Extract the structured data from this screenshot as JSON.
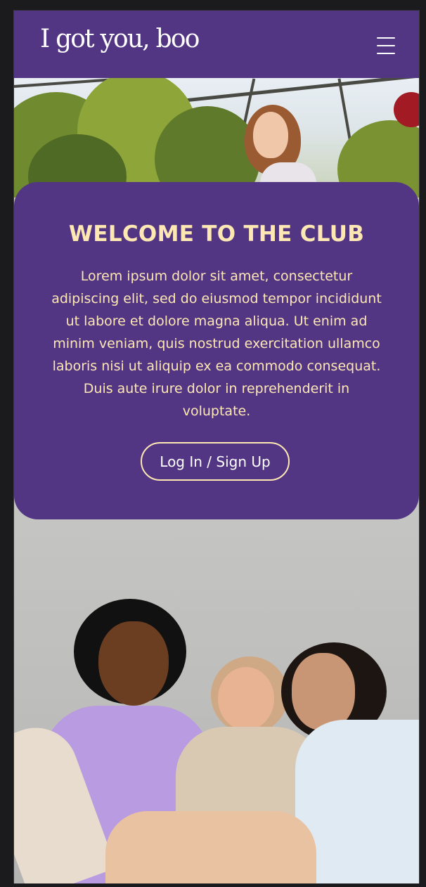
{
  "header": {
    "logo": "I got you, boo",
    "menu_icon": "hamburger-menu-icon"
  },
  "hero_top": {
    "image": "woman-smiling-in-greenhouse-photo"
  },
  "welcome_card": {
    "title": "WELCOME TO THE CLUB",
    "body": "Lorem ipsum dolor sit amet, consectetur adipiscing elit, sed do eiusmod tempor incididunt ut labore et dolore magna aliqua. Ut enim ad minim veniam, quis nostrud exercitation ullamco laboris nisi ut aliquip ex ea commodo consequat. Duis aute irure dolor in reprehenderit in voluptate.",
    "button_label": "Log In / Sign Up"
  },
  "hero_bottom": {
    "image": "three-women-laughing-photo"
  },
  "colors": {
    "brand_purple": "#523684",
    "cream_text": "#fde7b3",
    "page_background": "#1b1b1d"
  }
}
